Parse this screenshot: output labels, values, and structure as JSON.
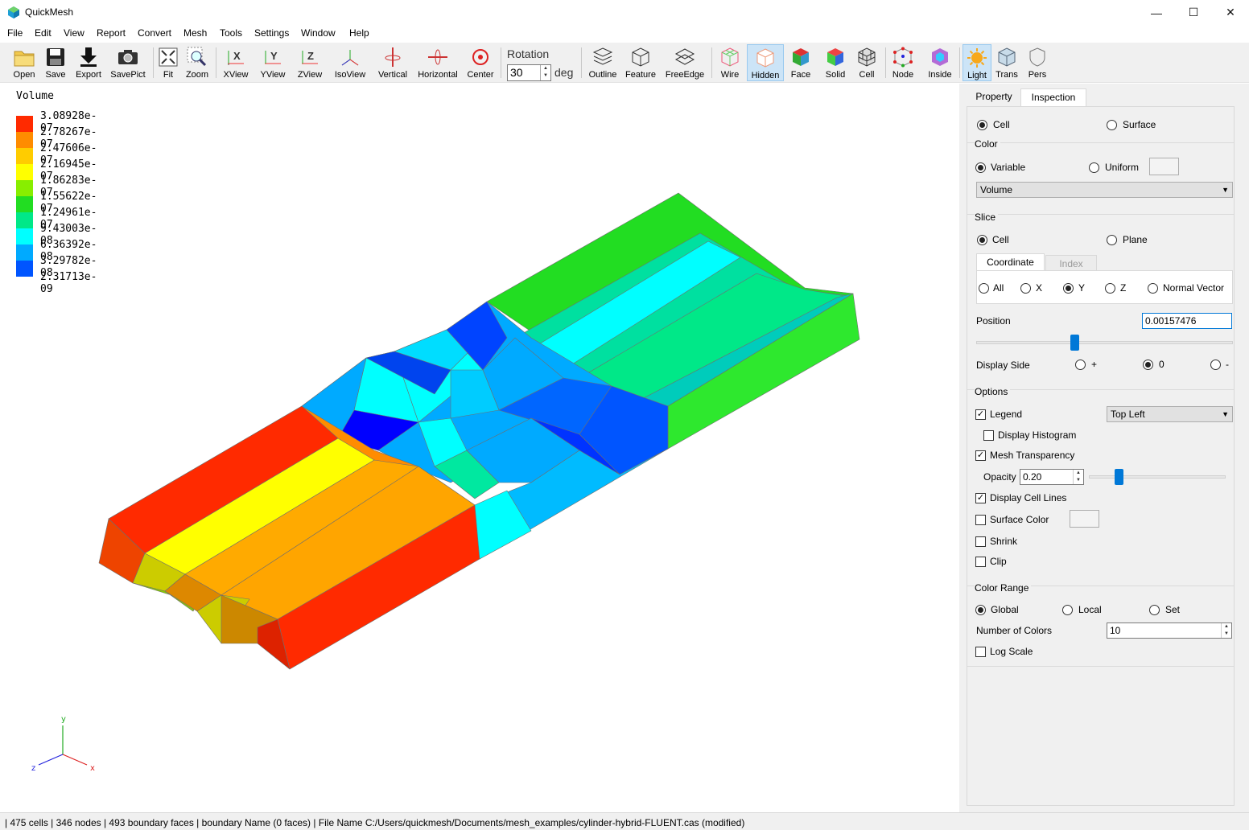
{
  "window": {
    "title": "QuickMesh",
    "minimize": "—",
    "maximize": "☐",
    "close": "✕"
  },
  "menu": [
    "File",
    "Edit",
    "View",
    "Report",
    "Convert",
    "Mesh",
    "Tools",
    "Settings",
    "Window",
    "Help"
  ],
  "toolbar": {
    "buttons": [
      {
        "label": "Open",
        "icon": "folder-icon"
      },
      {
        "label": "Save",
        "icon": "floppy-icon"
      },
      {
        "label": "Export",
        "icon": "download-icon"
      },
      {
        "label": "SavePict",
        "icon": "camera-icon"
      },
      {
        "label": "Fit",
        "icon": "fit-icon"
      },
      {
        "label": "Zoom",
        "icon": "zoom-icon"
      },
      {
        "label": "XView",
        "icon": "xview-icon"
      },
      {
        "label": "YView",
        "icon": "yview-icon"
      },
      {
        "label": "ZView",
        "icon": "zview-icon"
      },
      {
        "label": "IsoView",
        "icon": "isoview-icon"
      },
      {
        "label": "Vertical",
        "icon": "vertical-rotate-icon"
      },
      {
        "label": "Horizontal",
        "icon": "horizontal-rotate-icon"
      },
      {
        "label": "Center",
        "icon": "center-icon"
      },
      {
        "label": "Outline",
        "icon": "outline-icon"
      },
      {
        "label": "Feature",
        "icon": "feature-icon"
      },
      {
        "label": "FreeEdge",
        "icon": "freeedge-icon"
      },
      {
        "label": "Wire",
        "icon": "wire-icon"
      },
      {
        "label": "Hidden",
        "icon": "hidden-icon"
      },
      {
        "label": "Face",
        "icon": "face-icon"
      },
      {
        "label": "Solid",
        "icon": "solid-icon"
      },
      {
        "label": "Cell",
        "icon": "cell-icon"
      },
      {
        "label": "Node",
        "icon": "node-icon"
      },
      {
        "label": "Inside",
        "icon": "inside-icon"
      },
      {
        "label": "Light",
        "icon": "light-icon"
      },
      {
        "label": "Trans",
        "icon": "trans-icon"
      },
      {
        "label": "Pers",
        "icon": "pers-icon"
      }
    ],
    "rotation": {
      "label": "Rotation",
      "value": "30",
      "unit": "deg"
    }
  },
  "legend": {
    "title": "Volume",
    "values": [
      "3.08928e-07",
      "2.78267e-07",
      "2.47606e-07",
      "2.16945e-07",
      "1.86283e-07",
      "1.55622e-07",
      "1.24961e-07",
      "9.43003e-08",
      "6.36392e-08",
      "3.29782e-08",
      "2.31713e-09"
    ],
    "colors": [
      "#ff2a00",
      "#ff8c00",
      "#ffcc00",
      "#ffff00",
      "#88ee00",
      "#22dd22",
      "#00e888",
      "#00ffff",
      "#00aaff",
      "#0055ff",
      "#0000ff"
    ]
  },
  "axes": {
    "x": "x",
    "y": "y",
    "z": "z"
  },
  "panel": {
    "tabs": [
      "Property",
      "Inspection"
    ],
    "mode": {
      "cell": "Cell",
      "surface": "Surface"
    },
    "color": {
      "heading": "Color",
      "variable": "Variable",
      "uniform": "Uniform",
      "variable_select": "Volume"
    },
    "slice": {
      "heading": "Slice",
      "cell": "Cell",
      "plane": "Plane",
      "subtabs": [
        "Coordinate",
        "Index"
      ],
      "axes": [
        "All",
        "X",
        "Y",
        "Z",
        "Normal Vector"
      ],
      "position_label": "Position",
      "position_value": "0.00157476",
      "position_level": 0.5,
      "display_side_label": "Display Side",
      "sides": [
        "+",
        "0",
        "-"
      ]
    },
    "options": {
      "heading": "Options",
      "legend": "Legend",
      "legend_position": "Top Left",
      "display_histogram": "Display Histogram",
      "mesh_transparency": "Mesh Transparency",
      "opacity_label": "Opacity",
      "opacity_value": "0.20",
      "display_cell_lines": "Display Cell Lines",
      "surface_color": "Surface Color",
      "shrink": "Shrink",
      "clip": "Clip"
    },
    "color_range": {
      "heading": "Color Range",
      "global": "Global",
      "local": "Local",
      "set": "Set",
      "number_of_colors_label": "Number of Colors",
      "number_of_colors": "10",
      "log_scale": "Log Scale"
    }
  },
  "status": "| 475 cells | 346 nodes | 493 boundary faces |  boundary Name  (0 faces) | File Name C:/Users/quickmesh/Documents/mesh_examples/cylinder-hybrid-FLUENT.cas (modified)"
}
